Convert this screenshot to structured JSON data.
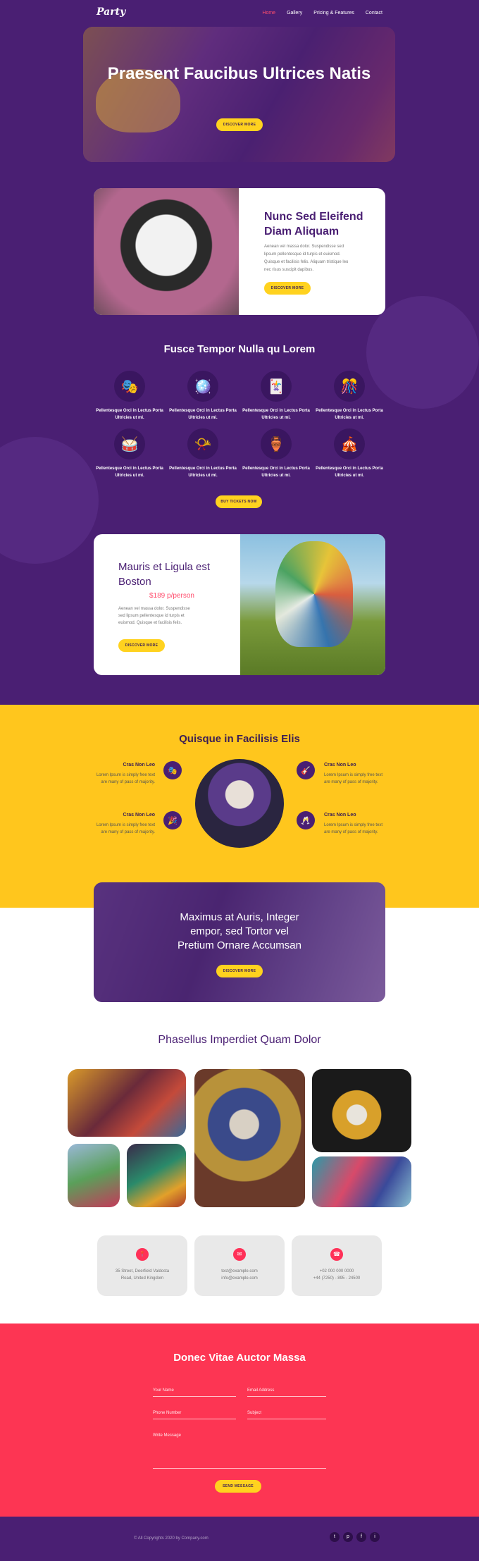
{
  "nav": {
    "logo": "Party",
    "items": [
      "Home",
      "Gallery",
      "Pricing & Features",
      "Contact"
    ]
  },
  "hero": {
    "title": "Praesent Faucibus Ultrices Natis",
    "button": "Discover More"
  },
  "card1": {
    "title": "Nunc Sed Eleifend Diam Aliquam",
    "text": "Aenean vel massa dolor. Suspendisse sed lipsum pellentesque id turpis et euismod. Quisque et facilisis felis. Aliquam tristique leo nec risus suscipit dapibus.",
    "button": "Discover More"
  },
  "features": {
    "title": "Fusce Tempor Nulla qu Lorem",
    "items": [
      {
        "icon": "🎭",
        "label": "Pellentesque Orci in Lectus Porta Ultricies ut mi."
      },
      {
        "icon": "🪩",
        "label": "Pellentesque Orci in Lectus Porta Ultricies ut mi."
      },
      {
        "icon": "🃏",
        "label": "Pellentesque Orci in Lectus Porta Ultricies ut mi."
      },
      {
        "icon": "🎊",
        "label": "Pellentesque Orci in Lectus Porta Ultricies ut mi."
      },
      {
        "icon": "🥁",
        "label": "Pellentesque Orci in Lectus Porta Ultricies ut mi."
      },
      {
        "icon": "📯",
        "label": "Pellentesque Orci in Lectus Porta Ultricies ut mi."
      },
      {
        "icon": "🏺",
        "label": "Pellentesque Orci in Lectus Porta Ultricies ut mi."
      },
      {
        "icon": "🎪",
        "label": "Pellentesque Orci in Lectus Porta Ultricies ut mi."
      }
    ],
    "button": "Buy Tickets Now"
  },
  "card2": {
    "title": "Mauris et Ligula est Boston",
    "price": "$189 p/person",
    "text": "Aenean vel massa dolor. Suspendisse sed lipsum pellentesque id turpis et euismod. Quisque et facilisis felis.",
    "button": "Discover More"
  },
  "yellow": {
    "title": "Quisque in Facilisis Elis",
    "items": [
      {
        "icon": "🎭",
        "title": "Cras Non Leo",
        "text": "Lorem Ipsum is simply free text are many of pass of majority."
      },
      {
        "icon": "🎉",
        "title": "Cras Non Leo",
        "text": "Lorem Ipsum is simply free text are many of pass of majority."
      },
      {
        "icon": "🎸",
        "title": "Cras Non Leo",
        "text": "Lorem Ipsum is simply free text are many of pass of majority."
      },
      {
        "icon": "🥂",
        "title": "Cras Non Leo",
        "text": "Lorem Ipsum is simply free text are many of pass of majority."
      }
    ]
  },
  "banner": {
    "title": "Maximus at Auris, Integer empor, sed Tortor vel Pretium Ornare Accumsan",
    "button": "Discover More"
  },
  "gallery": {
    "title": "Phasellus Imperdiet Quam Dolor"
  },
  "contact": {
    "cards": [
      {
        "icon": "📍",
        "line1": "35 Street, Deerfield Valdosta",
        "line2": "Road, United Kingdom"
      },
      {
        "icon": "✉",
        "line1": "test@example.com",
        "line2": "info@example.com"
      },
      {
        "icon": "☎",
        "line1": "+02 000 000 0000",
        "line2": "+44 (7250) - 895 - 24500"
      }
    ]
  },
  "form": {
    "title": "Donec Vitae Auctor Massa",
    "name": "Your Name",
    "email": "Email Address",
    "phone": "Phone Number",
    "subject": "Subject",
    "message": "Write Message",
    "button": "Send Message"
  },
  "footer": {
    "copyright": "© All Copyrights 2020 by Company.com",
    "social": [
      "t",
      "p",
      "f",
      "i"
    ]
  },
  "colors": {
    "purple": "#4a1f73",
    "yellow": "#ffc61d",
    "red": "#fd3553",
    "pink": "#ff4d6d"
  }
}
